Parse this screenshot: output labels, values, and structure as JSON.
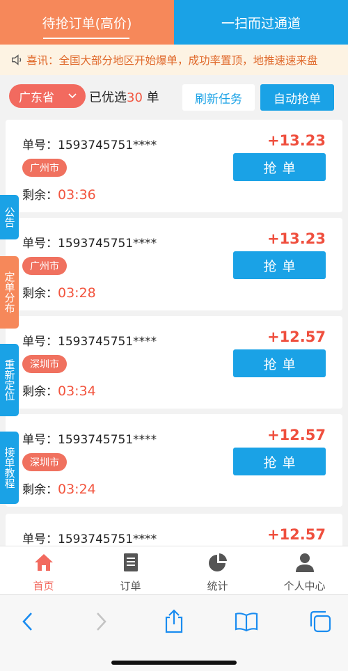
{
  "header": {
    "tab_left": "待抢订单(高价)",
    "tab_right": "一扫而过通道"
  },
  "notice": {
    "icon": "speaker-icon",
    "text": "喜讯：全国大部分地区开始爆单，成功率置顶，地推速速来盘"
  },
  "filter": {
    "province": "广东省",
    "selected_prefix": "已优选",
    "selected_count": "30",
    "selected_suffix": "单",
    "refresh_label": "刷新任务",
    "auto_label": "自动抢单"
  },
  "orders": [
    {
      "order_label": "单号：1593745751****",
      "city": "广州市",
      "remain_label": "剩余：",
      "time": "03:36",
      "amount": "+13.23",
      "grab_label": "抢单"
    },
    {
      "order_label": "单号：1593745751****",
      "city": "广州市",
      "remain_label": "剩余：",
      "time": "03:28",
      "amount": "+13.23",
      "grab_label": "抢单"
    },
    {
      "order_label": "单号：1593745751****",
      "city": "深圳市",
      "remain_label": "剩余：",
      "time": "03:34",
      "amount": "+12.57",
      "grab_label": "抢单"
    },
    {
      "order_label": "单号：1593745751****",
      "city": "深圳市",
      "remain_label": "剩余：",
      "time": "03:24",
      "amount": "+12.57",
      "grab_label": "抢单"
    },
    {
      "order_label": "单号：1593745751****",
      "amount": "+12.57"
    }
  ],
  "side_tabs": [
    {
      "label": "公告",
      "color": "#1aa2e6"
    },
    {
      "label": "定单分布",
      "color": "#f6885a"
    },
    {
      "label": "重新定位",
      "color": "#1aa2e6"
    },
    {
      "label": "接单教程",
      "color": "#1aa2e6"
    }
  ],
  "nav": [
    {
      "label": "首页",
      "icon": "home-icon"
    },
    {
      "label": "订单",
      "icon": "document-icon"
    },
    {
      "label": "统计",
      "icon": "pie-chart-icon"
    },
    {
      "label": "个人中心",
      "icon": "person-icon"
    }
  ],
  "colors": {
    "accent_blue": "#1aa2e6",
    "accent_orange": "#f6885a",
    "amount_red": "#ef4f3e"
  }
}
